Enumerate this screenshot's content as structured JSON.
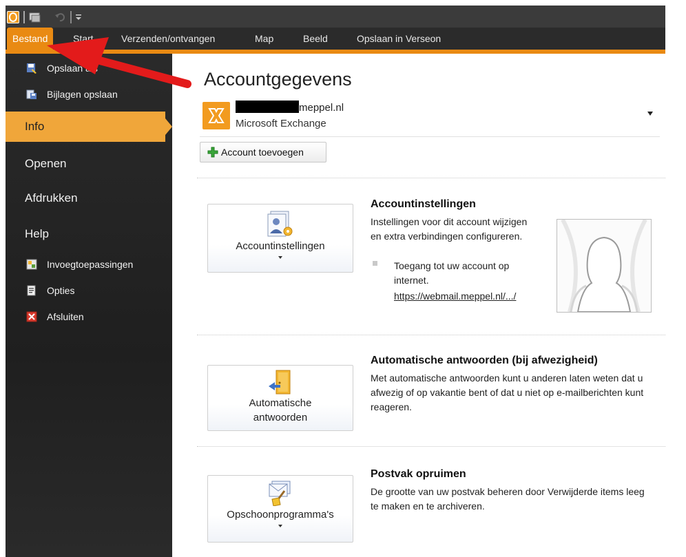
{
  "ribbon": {
    "tabs": [
      {
        "label": "Bestand",
        "active": true
      },
      {
        "label": "Start"
      },
      {
        "label": "Verzenden/ontvangen"
      },
      {
        "label": "Map"
      },
      {
        "label": "Beeld"
      },
      {
        "label": "Opslaan in Verseon"
      }
    ]
  },
  "sidebar": {
    "commands_top": [
      {
        "label": "Opslaan als",
        "icon": "save-as-icon"
      },
      {
        "label": "Bijlagen opslaan",
        "icon": "save-attachments-icon"
      }
    ],
    "tabs": [
      {
        "label": "Info",
        "active": true
      },
      {
        "label": "Openen"
      },
      {
        "label": "Afdrukken"
      },
      {
        "label": "Help"
      }
    ],
    "commands_bottom": [
      {
        "label": "Invoegtoepassingen",
        "icon": "addins-icon"
      },
      {
        "label": "Opties",
        "icon": "options-icon"
      },
      {
        "label": "Afsluiten",
        "icon": "exit-icon"
      }
    ]
  },
  "main": {
    "title": "Accountgegevens",
    "account": {
      "email_suffix": "meppel.nl",
      "type": "Microsoft Exchange"
    },
    "add_account_label": "Account toevoegen",
    "sections": [
      {
        "button_label": "Accountinstellingen",
        "title": "Accountinstellingen",
        "description": "Instellingen voor dit account wijzigen en extra verbindingen configureren.",
        "bullet": "Toegang tot uw account op internet.",
        "link": "https://webmail.meppel.nl/.../"
      },
      {
        "button_label_line1": "Automatische",
        "button_label_line2": "antwoorden",
        "title": "Automatische antwoorden (bij afwezigheid)",
        "description": "Met automatische antwoorden kunt u anderen laten weten dat u afwezig of op vakantie bent of dat u niet op e-mailberichten kunt reageren."
      },
      {
        "button_label": "Opschoonprogramma's",
        "title": "Postvak opruimen",
        "description": "De grootte van uw postvak beheren door Verwijderde items leeg te maken en te archiveren."
      }
    ]
  },
  "colors": {
    "accent": "#e98a13",
    "annotation_arrow": "#e31b1b",
    "sidebar_bg": "#242424"
  }
}
